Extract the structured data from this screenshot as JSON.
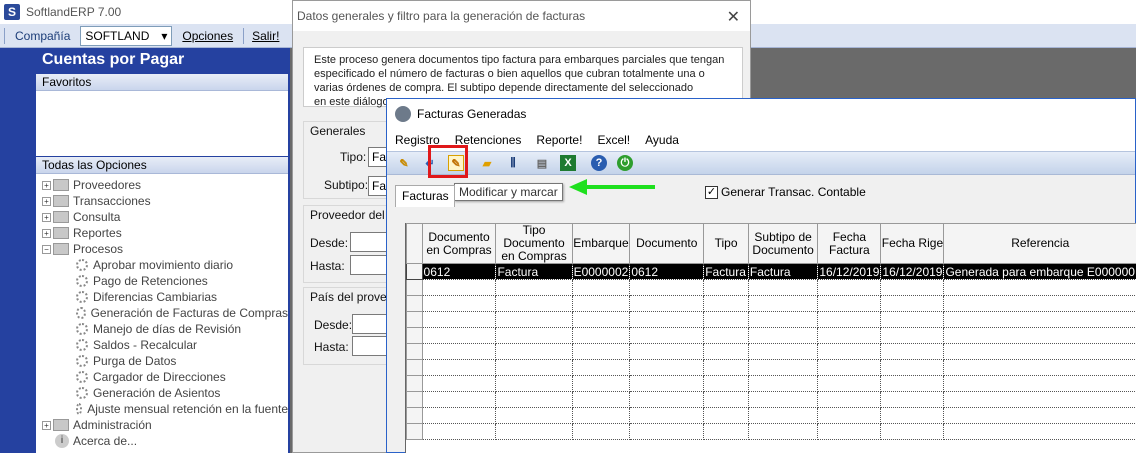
{
  "app": {
    "title": "SoftlandERP 7.00",
    "logo": "S"
  },
  "toolbar": {
    "company_label": "Compañía",
    "company_value": "SOFTLAND",
    "options_label": "Opciones",
    "exit_label": "Salir!"
  },
  "left_panel": {
    "title": "Cuentas por Pagar",
    "favorites_label": "Favoritos",
    "all_options_label": "Todas las Opciones",
    "tree": [
      {
        "label": "Proveedores",
        "expander": "+",
        "icon": "folder"
      },
      {
        "label": "Transacciones",
        "expander": "+",
        "icon": "folder"
      },
      {
        "label": "Consulta",
        "expander": "+",
        "icon": "folder"
      },
      {
        "label": "Reportes",
        "expander": "+",
        "icon": "folder"
      },
      {
        "label": "Procesos",
        "expander": "−",
        "icon": "folder"
      }
    ],
    "process_children": [
      "Aprobar movimiento diario",
      "Pago de Retenciones",
      "Diferencias Cambiarias",
      "Generación de Facturas de Compras",
      "Manejo de días de Revisión",
      "Saldos - Recalcular",
      "Purga de Datos",
      "Cargador de Direcciones",
      "Generación de Asientos",
      "Ajuste mensual retención en la fuente"
    ],
    "tree_tail": [
      {
        "label": "Administración",
        "expander": "+",
        "icon": "folder"
      },
      {
        "label": "Acerca de...",
        "expander": "",
        "icon": "info"
      }
    ]
  },
  "dialog1": {
    "title": "Datos generales y filtro para la generación de facturas",
    "close": "✕",
    "description": [
      "Este proceso genera documentos tipo factura para embarques parciales que tengan",
      "especificado el número de facturas o bien  aquellos que cubran totalmente una o",
      "varias órdenes de compra. El subtipo depende directamente del seleccionado",
      "en este diálogo."
    ],
    "general_title": "Generales",
    "tipo_label": "Tipo:",
    "tipo_value": "Fa",
    "subtipo_label": "Subtipo:",
    "subtipo_value": "Fa",
    "supplier_title": "Proveedor del e",
    "desde_label": "Desde:",
    "hasta_label": "Hasta:",
    "country_title": "País del provee",
    "desde2_label": "Desde:",
    "hasta2_label": "Hasta:"
  },
  "dialog2": {
    "title": "Facturas Generadas",
    "menu": [
      "Registro",
      "Retenciones",
      "Reporte!",
      "Excel!",
      "Ayuda"
    ],
    "tooltip": "Modificar y marcar",
    "tab": "Facturas",
    "checkbox_label": "Generar Transac. Contable",
    "checkbox_checked": "✓",
    "columns": [
      "Documento en Compras",
      "Tipo Documento en Compras",
      "Embarque",
      "Documento",
      "Tipo",
      "Subtipo de Documento",
      "Fecha Factura",
      "Fecha Rige",
      "Referencia"
    ],
    "rows": [
      [
        "0612",
        "Factura",
        "E0000002",
        "0612",
        "Factura",
        "Factura",
        "16/12/2019",
        "16/12/2019",
        "Generada para embarque E000000"
      ]
    ],
    "accent_color": "#2541a0",
    "highlight_color": "#e0181a",
    "arrow_color": "#1ee01e"
  }
}
